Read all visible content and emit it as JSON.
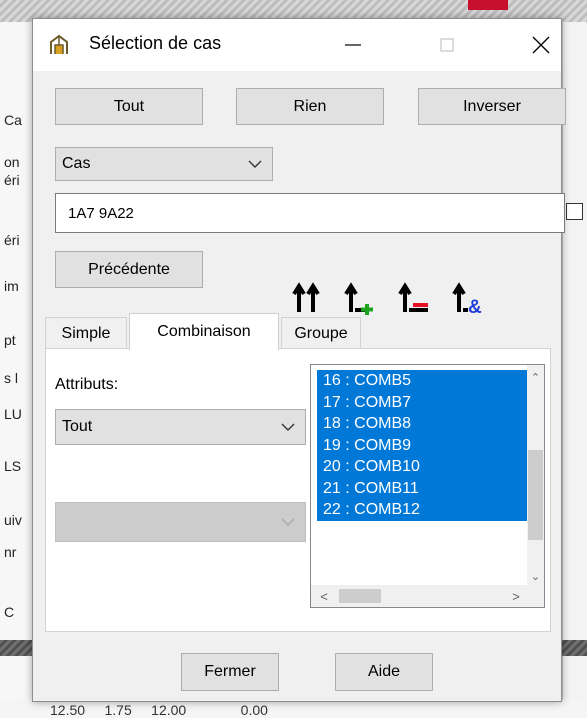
{
  "window": {
    "title": "Sélection de cas",
    "minimize_icon": "minimize-icon",
    "maximize_icon": "maximize-icon",
    "close_icon": "close-icon"
  },
  "background": {
    "left_fragments": [
      "Ca",
      "on",
      "éri",
      "éri",
      "im",
      "pt",
      "s l",
      "LU",
      "LS",
      "uiv",
      "nr",
      "C"
    ],
    "bottom_fragment": "12.50     1.75     12.00              0.00"
  },
  "selection_buttons": {
    "all": "Tout",
    "none": "Rien",
    "invert": "Inverser"
  },
  "type_select": {
    "value": "Cas"
  },
  "cases_input": {
    "value": "1A7 9A22"
  },
  "previous_button": "Précédente",
  "toolbar_icons": [
    "select-all-arrows-icon",
    "add-selection-icon",
    "remove-selection-icon",
    "intersect-selection-icon"
  ],
  "colors": {
    "selection": "#0078d7",
    "add": "#1fa31f",
    "remove": "#e81123",
    "intersect": "#1f3fd8"
  },
  "tabs": [
    {
      "label": "Simple",
      "active": false
    },
    {
      "label": "Combinaison",
      "active": true
    },
    {
      "label": "Groupe",
      "active": false
    }
  ],
  "panel": {
    "attributes_label": "Attributs:",
    "attributes_value": "Tout",
    "second_select_value": "",
    "combinations": [
      "16 : COMB5",
      "17 : COMB7",
      "18 : COMB8",
      "19 : COMB9",
      "20 : COMB10",
      "21 : COMB11",
      "22 : COMB12"
    ]
  },
  "footer": {
    "close": "Fermer",
    "help": "Aide"
  }
}
